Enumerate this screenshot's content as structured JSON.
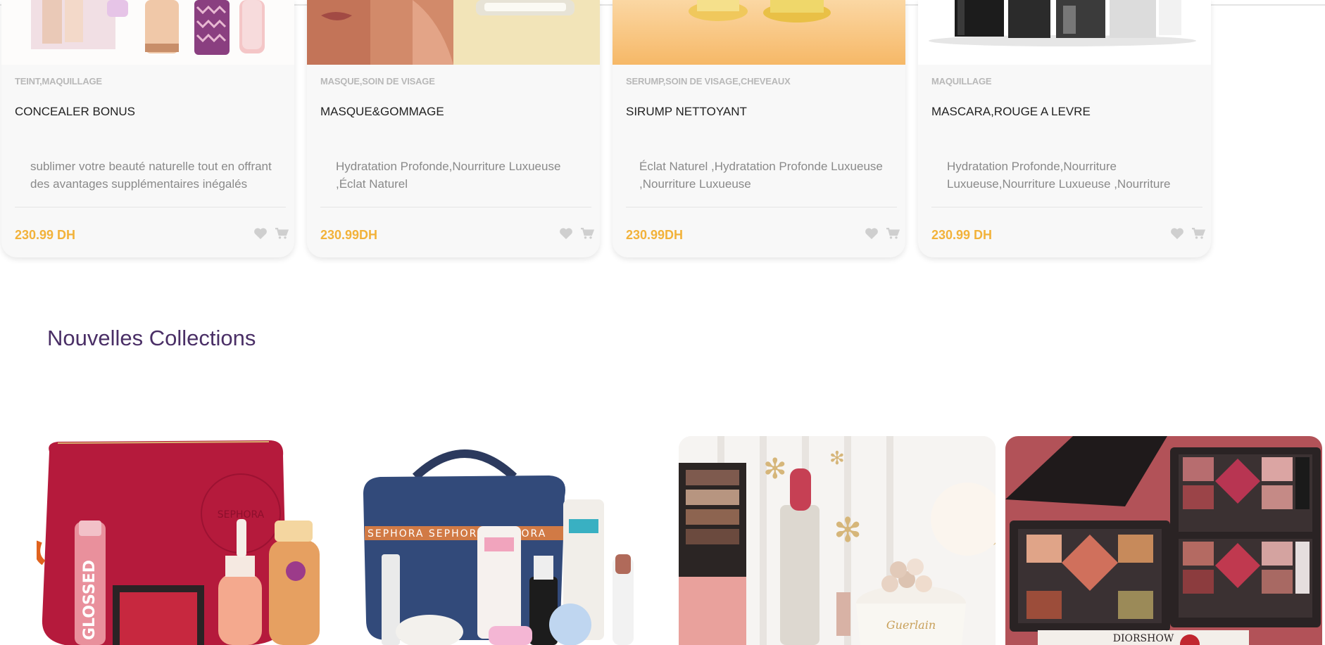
{
  "products": [
    {
      "category": "TEINT,MAQUILLAGE",
      "title": "CONCEALER BONUS",
      "description": "sublimer votre beauté naturelle tout en offrant des avantages supplémentaires inégalés",
      "price": "230.99 DH",
      "image_icon": "makeup-products-image"
    },
    {
      "category": "MASQUE,SOIN DE VISAGE",
      "title": "MASQUE&GOMMAGE",
      "description": "Hydratation Profonde,Nourriture Luxueuse ,Éclat Naturel",
      "price": "230.99DH",
      "image_icon": "face-mask-image"
    },
    {
      "category": "SERUMP,SOIN DE VISAGE,CHEVEAUX",
      "title": "SIRUMP NETTOYANT",
      "description": "Éclat Naturel ,Hydratation Profonde Luxueuse ,Nourriture Luxueuse",
      "price": "230.99DH",
      "image_icon": "serum-bottles-image"
    },
    {
      "category": "MAQUILLAGE",
      "title": "MASCARA,ROUGE A LEVRE",
      "description": "Hydratation Profonde,Nourriture Luxueuse,Nourriture Luxueuse ,Nourriture",
      "price": "230.99 DH",
      "image_icon": "mascara-set-image"
    }
  ],
  "section": {
    "title": "Nouvelles Collections"
  },
  "collections": [
    {
      "name": "red-pouch-set",
      "icon": "red-sephora-pouch-image",
      "text": [
        "SEPHORA",
        "GLOSSED"
      ]
    },
    {
      "name": "denim-vanity-set",
      "icon": "denim-vanity-case-image",
      "text": [
        "SEPHORA SEPHORA SEPHORA"
      ]
    },
    {
      "name": "guerlain-set",
      "icon": "guerlain-holiday-image",
      "text": [
        "Guerlain"
      ]
    },
    {
      "name": "dior-palette-set",
      "icon": "dior-palette-image",
      "text": [
        "DIORSHOW"
      ]
    }
  ],
  "colors": {
    "accent_price": "#f2b23a",
    "heading": "#4a2f66",
    "category": "#b8b8b8",
    "card_bg": "#f8f8f8"
  }
}
